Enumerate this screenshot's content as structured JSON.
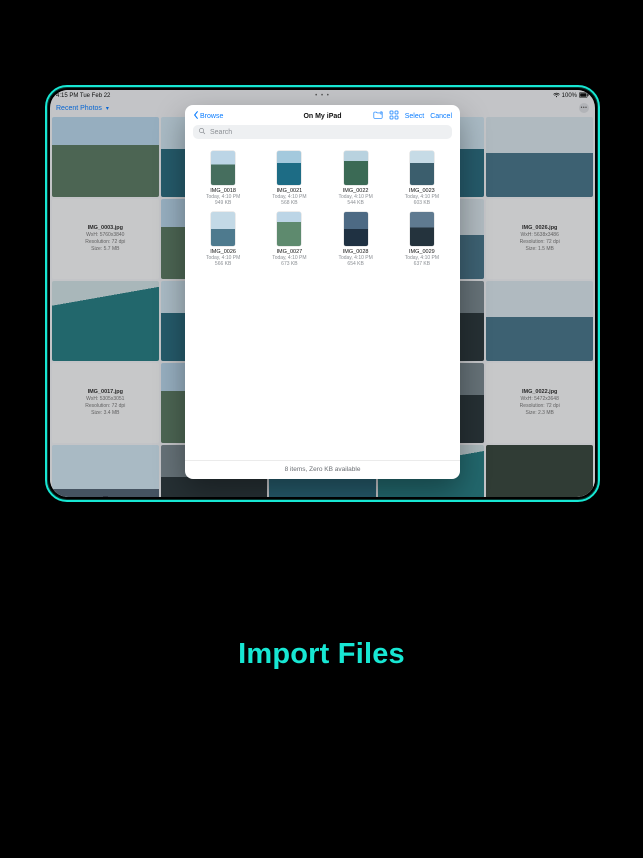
{
  "caption": "Import Files",
  "statusbar": {
    "time_date": "4:15 PM   Tue Feb 22",
    "dots": "• • •",
    "battery_pct": "100%"
  },
  "app_header": {
    "title": "Recent Photos"
  },
  "bg_info": [
    {
      "filename": "IMG_0003.jpg",
      "wxh": "WxH: 5760x3840",
      "res": "Resolution: 72 dpi",
      "size": "Size: 5.7 MB"
    },
    {
      "filename": "IMG_0026.jpg",
      "wxh": "WxH: 5638x3486",
      "res": "Resolution: 72 dpi",
      "size": "Size: 1.5 MB"
    },
    {
      "filename": "IMG_0017.jpg",
      "wxh": "WxH: 5305x3051",
      "res": "Resolution: 72 dpi",
      "size": "Size: 3.4 MB"
    },
    {
      "filename": "IMG_0022.jpg",
      "wxh": "WxH: 5472x3648",
      "res": "Resolution: 72 dpi",
      "size": "Size: 2.3 MB"
    }
  ],
  "modal": {
    "back_label": "Browse",
    "title": "On My iPad",
    "select_label": "Select",
    "cancel_label": "Cancel",
    "search_placeholder": "Search",
    "footer": "8 items, Zero KB available",
    "files": [
      {
        "name": "IMG_0018",
        "time": "Today, 4:10 PM",
        "size": "949 KB"
      },
      {
        "name": "IMG_0021",
        "time": "Today, 4:10 PM",
        "size": "568 KB"
      },
      {
        "name": "IMG_0022",
        "time": "Today, 4:10 PM",
        "size": "544 KB"
      },
      {
        "name": "IMG_0023",
        "time": "Today, 4:10 PM",
        "size": "603 KB"
      },
      {
        "name": "IMG_0026",
        "time": "Today, 4:10 PM",
        "size": "566 KB"
      },
      {
        "name": "IMG_0027",
        "time": "Today, 4:10 PM",
        "size": "673 KB"
      },
      {
        "name": "IMG_0028",
        "time": "Today, 4:10 PM",
        "size": "654 KB"
      },
      {
        "name": "IMG_0029",
        "time": "Today, 4:10 PM",
        "size": "637 KB"
      }
    ]
  }
}
